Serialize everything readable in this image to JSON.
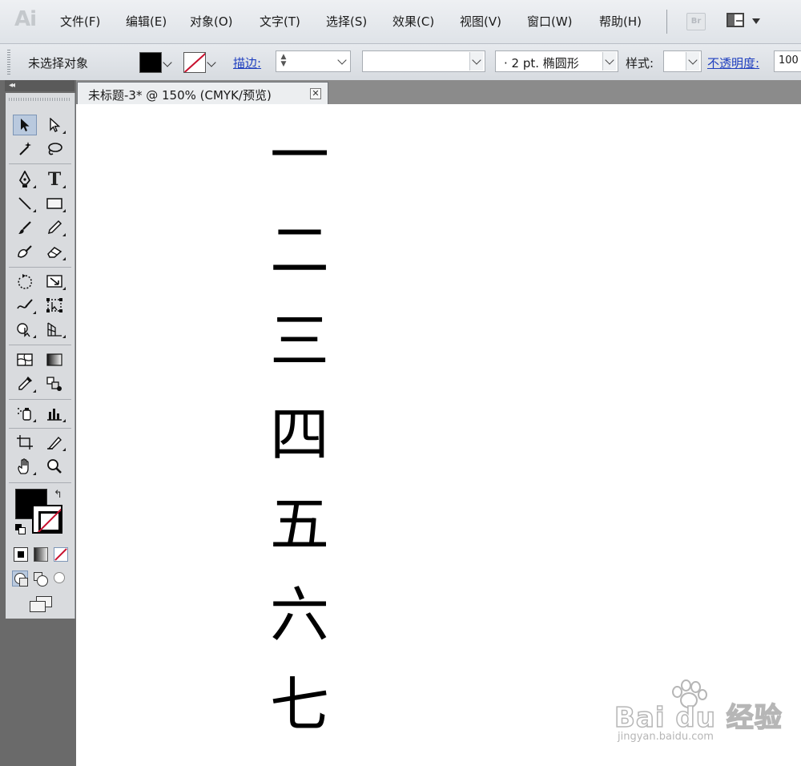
{
  "app": {
    "logo": "Ai"
  },
  "menu": [
    {
      "label": "文件(F)"
    },
    {
      "label": "编辑(E)"
    },
    {
      "label": "对象(O)"
    },
    {
      "label": "文字(T)"
    },
    {
      "label": "选择(S)"
    },
    {
      "label": "效果(C)"
    },
    {
      "label": "视图(V)"
    },
    {
      "label": "窗口(W)"
    },
    {
      "label": "帮助(H)"
    }
  ],
  "bridge_button": "Br",
  "control": {
    "selection_label": "未选择对象",
    "stroke_label": "描边:",
    "brush_value": "·  2 pt. 椭圆形",
    "style_label": "样式:",
    "opacity_label": "不透明度:",
    "opacity_value": "100"
  },
  "document": {
    "tab_title": "未标题-3* @ 150% (CMYK/预览)",
    "close_glyph": "✕",
    "characters": [
      "一",
      "二",
      "三",
      "四",
      "五",
      "六",
      "七"
    ]
  },
  "tools_panel": {
    "collapse_glyph": "◂◂"
  },
  "colors": {
    "accent_link": "#1f3fbf",
    "none_stroke": "#c8102e",
    "canvas": "#ffffff",
    "pasteboard": "#6a6a6a"
  },
  "icons": [
    "selection-icon",
    "direct-selection-icon",
    "magic-wand-icon",
    "lasso-icon",
    "pen-icon",
    "type-icon",
    "line-segment-icon",
    "rectangle-icon",
    "paintbrush-icon",
    "pencil-icon",
    "blob-brush-icon",
    "eraser-icon",
    "rotate-icon",
    "scale-icon",
    "warp-icon",
    "free-transform-icon",
    "shape-builder-icon",
    "perspective-grid-icon",
    "mesh-icon",
    "gradient-icon",
    "eyedropper-icon",
    "blend-icon",
    "symbol-sprayer-icon",
    "column-graph-icon",
    "artboard-icon",
    "slice-icon",
    "hand-icon",
    "zoom-icon"
  ],
  "watermark": {
    "word": "Bai du 经验",
    "url": "jingyan.baidu.com"
  }
}
